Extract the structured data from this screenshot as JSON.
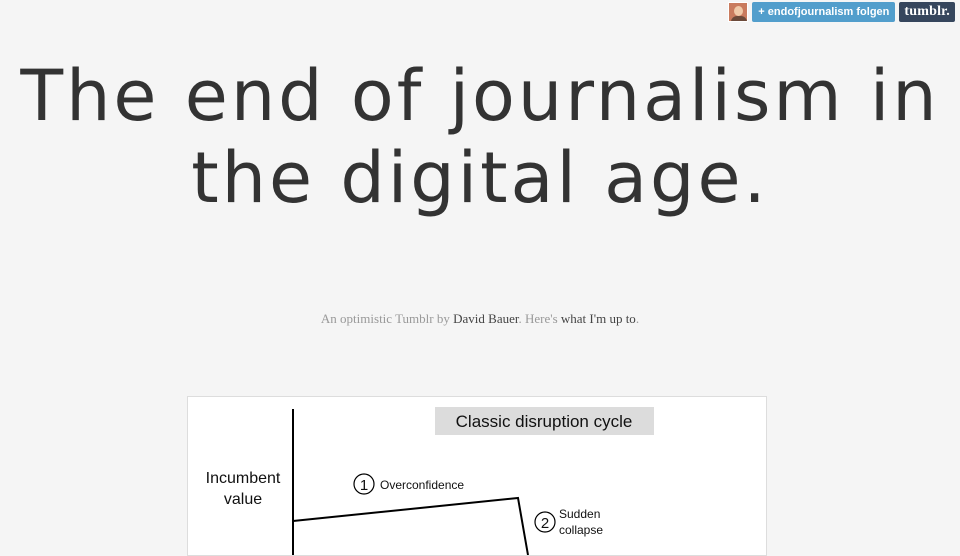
{
  "topbar": {
    "follow_label": "+ endofjournalism folgen",
    "tumblr_label": "tumblr."
  },
  "title": "The end of journalism in the digital age.",
  "subtitle": {
    "part1": "An optimistic Tumblr by ",
    "author": "David Bauer",
    "part2": ". Here's ",
    "link": "what I'm up to",
    "part3": "."
  },
  "figure": {
    "heading": "Classic disruption cycle",
    "ylabel_line1": "Incumbent",
    "ylabel_line2": "value",
    "step1_number": "1",
    "step1_label": "Overconfidence",
    "step2_number": "2",
    "step2_label_line1": "Sudden",
    "step2_label_line2": "collapse"
  },
  "colors": {
    "follow": "#529ecc",
    "tumblr": "#36465d",
    "title": "#333333"
  }
}
